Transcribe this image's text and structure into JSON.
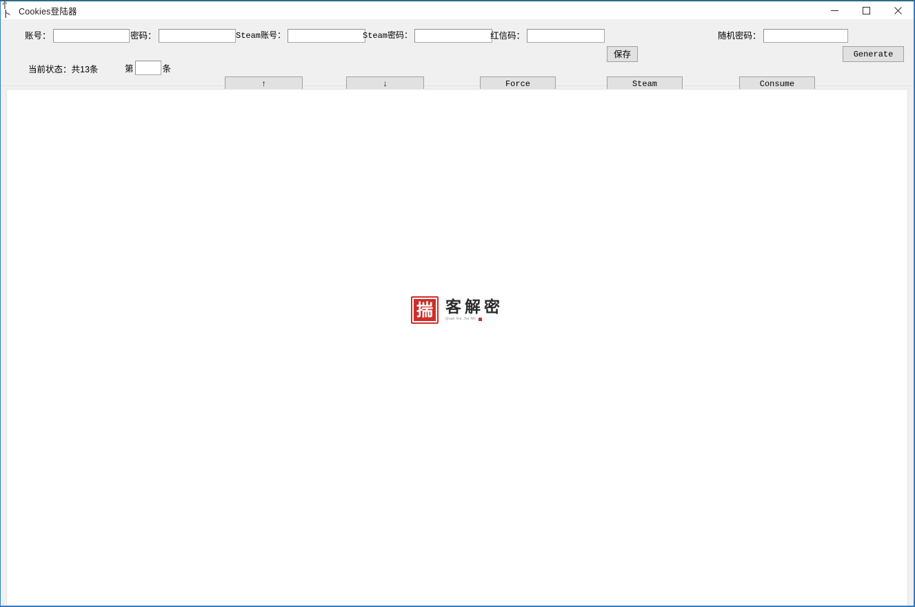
{
  "window": {
    "title": "Cookies登陆器",
    "icon": "app-glyph-icon",
    "accent_color": "#2e7cc0",
    "titlebar_background": "#ffffff",
    "toolbar_background": "#f0f0f0",
    "content_background": "#ffffff"
  },
  "window_controls": {
    "minimize": "minimize-icon",
    "maximize": "maximize-icon",
    "close": "close-icon"
  },
  "toolbar": {
    "row1": {
      "account_label": "账号：",
      "account_value": "",
      "password_label": "密码：",
      "password_value": "",
      "steam_account_label": "Steam账号：",
      "steam_account_value": "",
      "steam_password_label": "Steam密码：",
      "steam_password_value": "",
      "red_code_label": "红信码：",
      "red_code_value": "",
      "save_label": "保存",
      "random_password_label": "随机密码：",
      "random_password_value": "",
      "generate_label": "Generate"
    },
    "row2": {
      "status_label": "当前状态：共13条",
      "nth_prefix": "第",
      "nth_value": "",
      "nth_suffix": "条",
      "up_label": "↑",
      "down_label": "↓",
      "force_label": "Force",
      "steam_label": "Steam",
      "consume_label": "Consume"
    }
  },
  "watermark": {
    "seal_char": "揣",
    "brand_cn": "客解密",
    "brand_pinyin": "Qian Ke Jie Mi",
    "seal_color": "#cc1c17"
  }
}
